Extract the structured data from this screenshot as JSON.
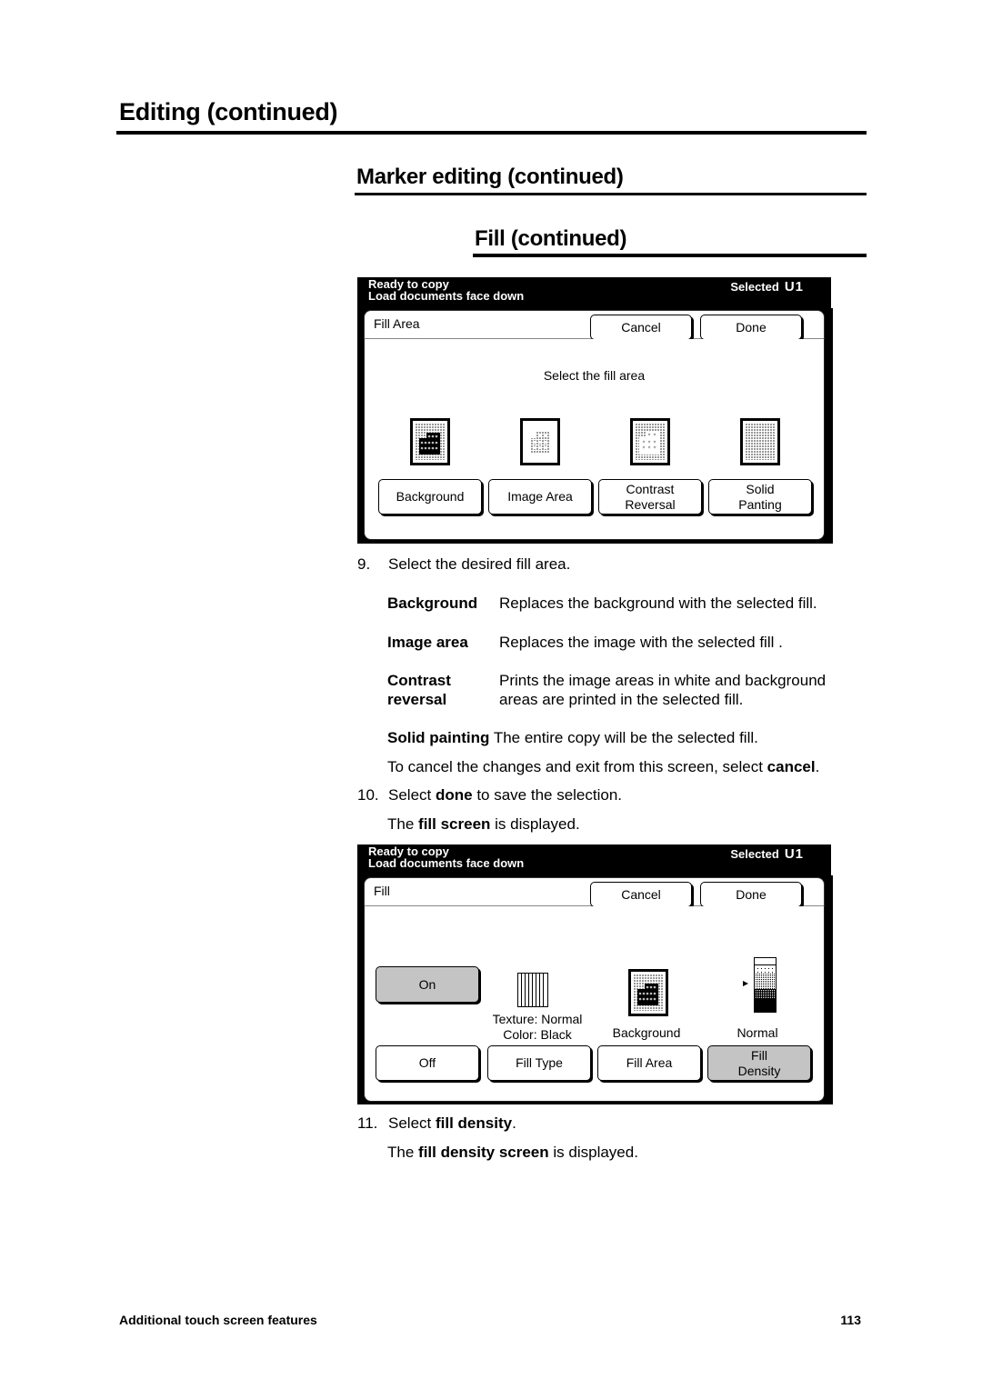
{
  "headings": {
    "h1": "Editing (continued)",
    "h2": "Marker editing (continued)",
    "h3": "Fill (continued)"
  },
  "screen1": {
    "status_line1": "Ready to copy",
    "status_line2": "Load documents face down",
    "selected_label": "Selected",
    "selected_value": "U1",
    "title": "Fill Area",
    "cancel_label": "Cancel",
    "done_label": "Done",
    "prompt": "Select the fill area",
    "options": [
      {
        "label_line1": "Background",
        "label_line2": "",
        "icon": "background-fill-icon"
      },
      {
        "label_line1": "Image Area",
        "label_line2": "",
        "icon": "image-area-fill-icon"
      },
      {
        "label_line1": "Contrast",
        "label_line2": "Reversal",
        "icon": "contrast-reversal-icon"
      },
      {
        "label_line1": "Solid",
        "label_line2": "Panting",
        "icon": "solid-painting-icon"
      }
    ]
  },
  "steps": {
    "step9": {
      "num": "9.",
      "text": "Select the desired fill area."
    },
    "definitions": [
      {
        "term": "Background",
        "desc": "Replaces the background with the selected fill."
      },
      {
        "term": "Image area",
        "desc": "Replaces the image with the selected fill ."
      },
      {
        "term_line1": "Contrast",
        "term_line2": "reversal",
        "desc_line1": "Prints the image areas in white and background",
        "desc_line2": "areas are printed in the selected fill."
      },
      {
        "term": "Solid painting",
        "desc": "The entire copy will be the selected fill."
      }
    ],
    "cancel_note": {
      "pre": "To cancel the changes and exit from this screen, select ",
      "bold": "cancel",
      "post": "."
    },
    "step10": {
      "num": "10.",
      "pre": "Select ",
      "bold": "done",
      "post": " to save the selection."
    },
    "step10_result": {
      "pre": "The ",
      "bold": "fill screen",
      "post": " is displayed."
    },
    "step11": {
      "num": "11.",
      "pre": "Select ",
      "bold": "fill density",
      "post": "."
    },
    "step11_result": {
      "pre": "The ",
      "bold": "fill density screen",
      "post": " is displayed."
    }
  },
  "screen2": {
    "status_line1": "Ready to copy",
    "status_line2": "Load documents face down",
    "selected_label": "Selected",
    "selected_value": "U1",
    "title": "Fill",
    "cancel_label": "Cancel",
    "done_label": "Done",
    "on_label": "On",
    "off_label": "Off",
    "fill_type": {
      "status_line1": "Texture: Normal",
      "status_line2": "Color: Black",
      "button": "Fill Type"
    },
    "fill_area": {
      "status": "Background",
      "button": "Fill Area"
    },
    "fill_density": {
      "status": "Normal",
      "button_line1": "Fill",
      "button_line2": "Density"
    },
    "selected_toggle": "On"
  },
  "footer": {
    "section": "Additional touch screen features",
    "page": "113"
  }
}
